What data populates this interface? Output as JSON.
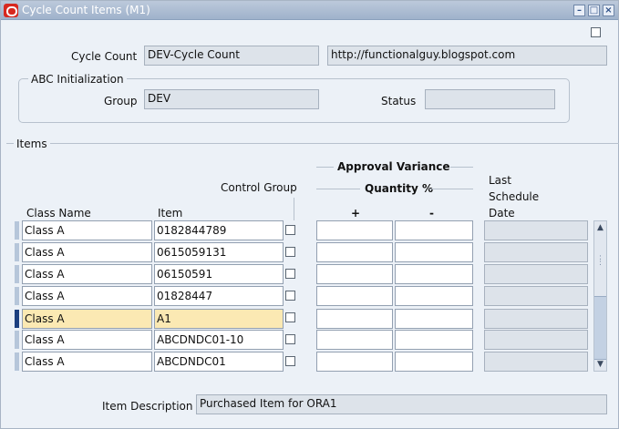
{
  "window": {
    "title": "Cycle Count Items (M1)"
  },
  "header": {
    "cycle_count_label": "Cycle Count",
    "cycle_count_value": "DEV-Cycle Count",
    "description_value": "http://functionalguy.blogspot.com"
  },
  "abc": {
    "section_label": "ABC Initialization",
    "group_label": "Group",
    "group_value": "DEV",
    "status_label": "Status",
    "status_value": ""
  },
  "items": {
    "section_label": "Items",
    "col_class": "Class Name",
    "col_item": "Item",
    "col_control": "Control Group",
    "col_approval": "Approval Variance",
    "col_qty": "Quantity %",
    "col_plus": "+",
    "col_minus": "-",
    "col_last1": "Last",
    "col_last2": "Schedule",
    "col_last3": "Date",
    "rows": [
      {
        "class_name": "Class A",
        "item": "0182844789",
        "current": false
      },
      {
        "class_name": "Class A",
        "item": "0615059131",
        "current": false
      },
      {
        "class_name": "Class A",
        "item": "06150591",
        "current": false
      },
      {
        "class_name": "Class A",
        "item": "01828447",
        "current": false
      },
      {
        "class_name": "Class A",
        "item": "A1",
        "current": true
      },
      {
        "class_name": "Class A",
        "item": "ABCDNDC01-10",
        "current": false
      },
      {
        "class_name": "Class A",
        "item": "ABCDNDC01",
        "current": false
      }
    ]
  },
  "footer": {
    "item_desc_label": "Item Description",
    "item_desc_value": "Purchased Item for ORA1"
  },
  "colors": {
    "title_bar": "#a9bad2",
    "highlight": "#fbe9b3",
    "current_marker": "#1c3f7f"
  }
}
